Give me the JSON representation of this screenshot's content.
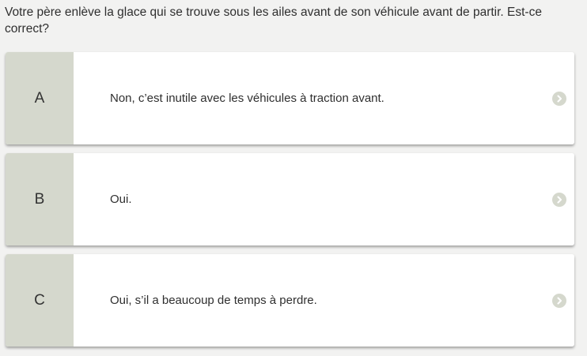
{
  "question": {
    "text": "Votre père enlève la glace qui se trouve sous les ailes avant de son véhicule avant de partir. Est-ce correct?"
  },
  "options": [
    {
      "letter": "A",
      "text": "Non, c’est inutile avec les véhicules à traction avant.",
      "icon": "chevron-right-circle-icon"
    },
    {
      "letter": "B",
      "text": "Oui.",
      "icon": "chevron-right-circle-icon"
    },
    {
      "letter": "C",
      "text": "Oui, s’il a beaucoup de temps à perdre.",
      "icon": "chevron-right-circle-icon"
    }
  ],
  "colors": {
    "letter_box": "#d5d8cd",
    "arrow_circle": "#d5d8cd",
    "background": "#f2f2f1"
  }
}
